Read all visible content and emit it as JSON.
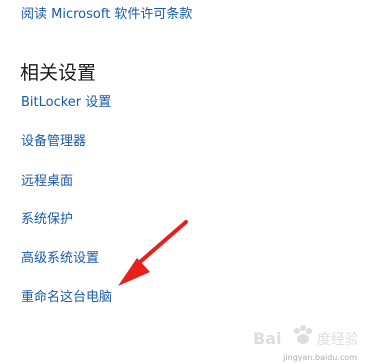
{
  "links": {
    "license": "阅读 Microsoft 软件许可条款",
    "bitlocker": "BitLocker 设置",
    "device_manager": "设备管理器",
    "remote_desktop": "远程桌面",
    "system_protection": "系统保护",
    "advanced_settings": "高级系统设置",
    "rename_pc": "重命名这台电脑"
  },
  "section": {
    "title": "相关设置"
  },
  "colors": {
    "link": "#1a5aa8",
    "title": "#1a1a1a",
    "arrow": "#e8201a",
    "background": "#ffffff"
  },
  "annotation": {
    "icon": "red-arrow-icon"
  },
  "watermark": {
    "text": "Bai度经验",
    "url": "jingyan.baidu.com"
  }
}
